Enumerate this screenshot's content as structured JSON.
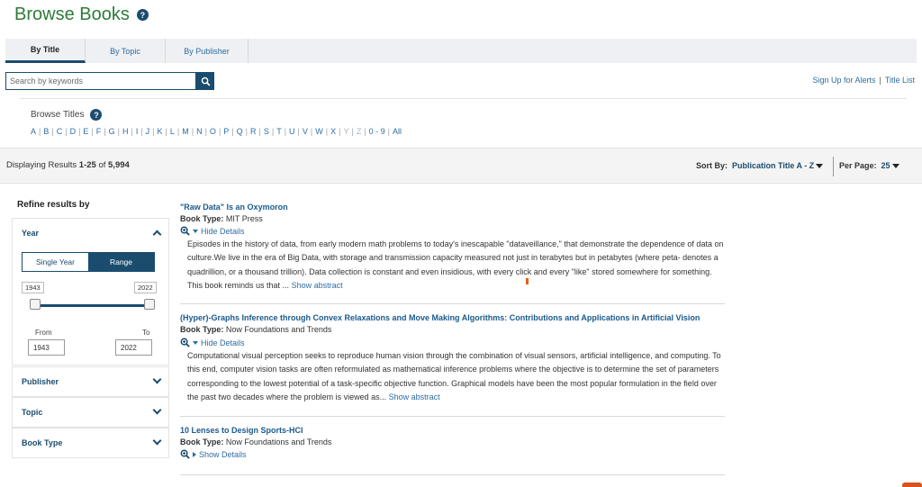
{
  "page": {
    "title": "Browse Books"
  },
  "tabs": [
    {
      "label": "By Title",
      "active": true
    },
    {
      "label": "By Topic",
      "active": false
    },
    {
      "label": "By Publisher",
      "active": false
    }
  ],
  "search": {
    "placeholder": "Search by keywords",
    "value": ""
  },
  "top_links": {
    "alerts": "Sign Up for Alerts",
    "separator": "|",
    "title_list": "Title List"
  },
  "browse": {
    "label": "Browse Titles",
    "letters": [
      {
        "t": "A",
        "enabled": true
      },
      {
        "t": "B",
        "enabled": true
      },
      {
        "t": "C",
        "enabled": true
      },
      {
        "t": "D",
        "enabled": true
      },
      {
        "t": "E",
        "enabled": true
      },
      {
        "t": "F",
        "enabled": true
      },
      {
        "t": "G",
        "enabled": true
      },
      {
        "t": "H",
        "enabled": true
      },
      {
        "t": "I",
        "enabled": true
      },
      {
        "t": "J",
        "enabled": true
      },
      {
        "t": "K",
        "enabled": true
      },
      {
        "t": "L",
        "enabled": true
      },
      {
        "t": "M",
        "enabled": true
      },
      {
        "t": "N",
        "enabled": true
      },
      {
        "t": "O",
        "enabled": true
      },
      {
        "t": "P",
        "enabled": true
      },
      {
        "t": "Q",
        "enabled": true
      },
      {
        "t": "R",
        "enabled": true
      },
      {
        "t": "S",
        "enabled": true
      },
      {
        "t": "T",
        "enabled": true
      },
      {
        "t": "U",
        "enabled": true
      },
      {
        "t": "V",
        "enabled": true
      },
      {
        "t": "W",
        "enabled": true
      },
      {
        "t": "X",
        "enabled": true
      },
      {
        "t": "Y",
        "enabled": false
      },
      {
        "t": "Z",
        "enabled": false
      },
      {
        "t": "0 - 9",
        "enabled": true
      },
      {
        "t": "All",
        "enabled": true
      }
    ]
  },
  "results": {
    "prefix": "Displaying Results ",
    "range": "1-25",
    "of": " of ",
    "total": "5,994",
    "sort_label": "Sort By:",
    "sort_value": "Publication Title A - Z",
    "per_page_label": "Per Page:",
    "per_page_value": "25"
  },
  "sidebar": {
    "title": "Refine results by",
    "year": {
      "label": "Year",
      "single_year": "Single Year",
      "range": "Range",
      "min": "1943",
      "max": "2022",
      "from_label": "From",
      "to_label": "To",
      "from_value": "1943",
      "to_value": "2022"
    },
    "facets": [
      "Publisher",
      "Topic",
      "Book Type"
    ]
  },
  "items": [
    {
      "title": "\"Raw Data\" Is an Oxymoron",
      "type_label": "Book Type:",
      "type_value": "MIT Press",
      "toggle": "Hide Details",
      "abstract": "Episodes in the history of data, from early modern math problems to today's inescapable \"dataveillance,\" that demonstrate the dependence of data on culture.We live in the era of Big Data, with storage and transmission capacity measured not just in terabytes but in petabytes (where peta- denotes a quadrillion, or a thousand trillion). Data collection is constant and even insidious, with every click and every \"like\" stored somewhere for something. This book reminds us that ...",
      "more": "Show abstract"
    },
    {
      "title": "(Hyper)-Graphs Inference through Convex Relaxations and Move Making Algorithms: Contributions and Applications in Artificial Vision",
      "type_label": "Book Type:",
      "type_value": "Now Foundations and Trends",
      "toggle": "Hide Details",
      "abstract": "Computational visual perception seeks to reproduce human vision through the combination of visual sensors, artificial intelligence, and computing. To this end, computer vision tasks are often reformulated as mathematical inference problems where the objective is to determine the set of parameters corresponding to the lowest potential of a task-specific objective function. Graphical models have been the most popular formulation in the field over the past two decades where the problem is viewed as...",
      "more": "Show abstract"
    },
    {
      "title": "10 Lenses to Design Sports-HCI",
      "type_label": "Book Type:",
      "type_value": "Now Foundations and Trends",
      "toggle": "Show Details"
    }
  ]
}
